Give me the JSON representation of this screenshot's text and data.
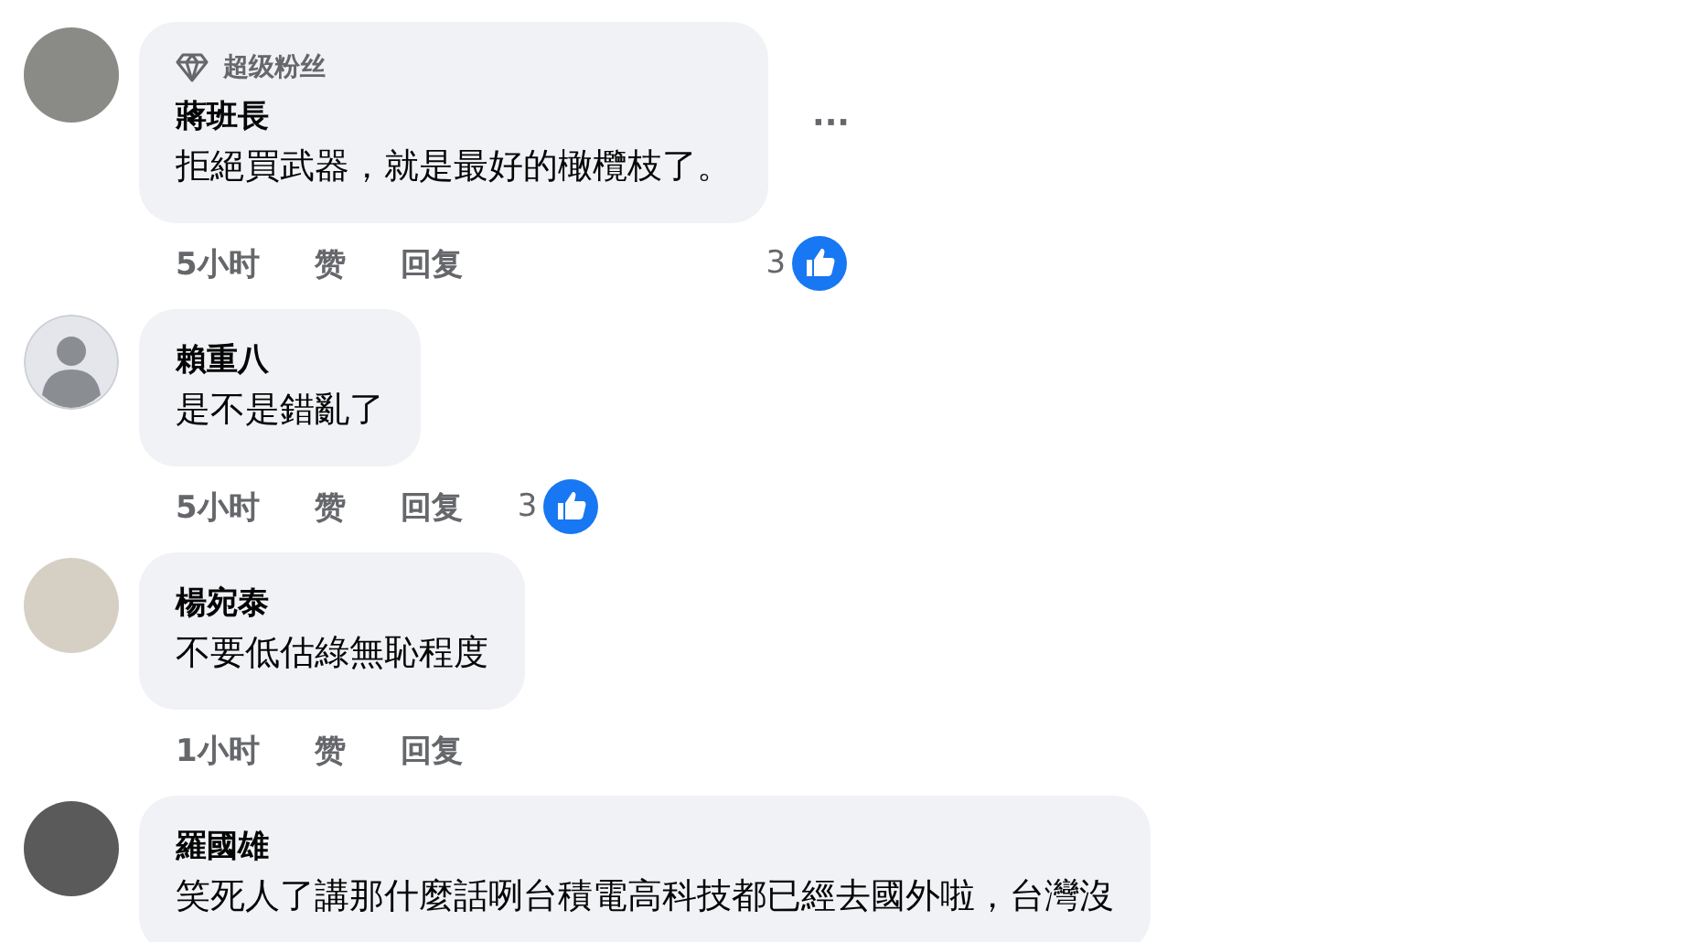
{
  "comments": [
    {
      "kind": "photo",
      "badge": "超级粉丝",
      "name": "蔣班長",
      "text": "拒絕買武器，就是最好的橄欖枝了。",
      "time": "5小时",
      "like": "赞",
      "reply": "回复",
      "reactions": "3",
      "more": "···"
    },
    {
      "kind": "default",
      "name": "賴重八",
      "text": "是不是錯亂了",
      "time": "5小时",
      "like": "赞",
      "reply": "回复",
      "reactions": "3"
    },
    {
      "kind": "photo",
      "name": "楊宛泰",
      "text": "不要低估綠無恥程度",
      "time": "1小时",
      "like": "赞",
      "reply": "回复"
    },
    {
      "kind": "photo",
      "name": "羅國雄",
      "text": "笑死人了講那什麼話咧台積電高科技都已經去國外啦，台灣沒"
    }
  ]
}
